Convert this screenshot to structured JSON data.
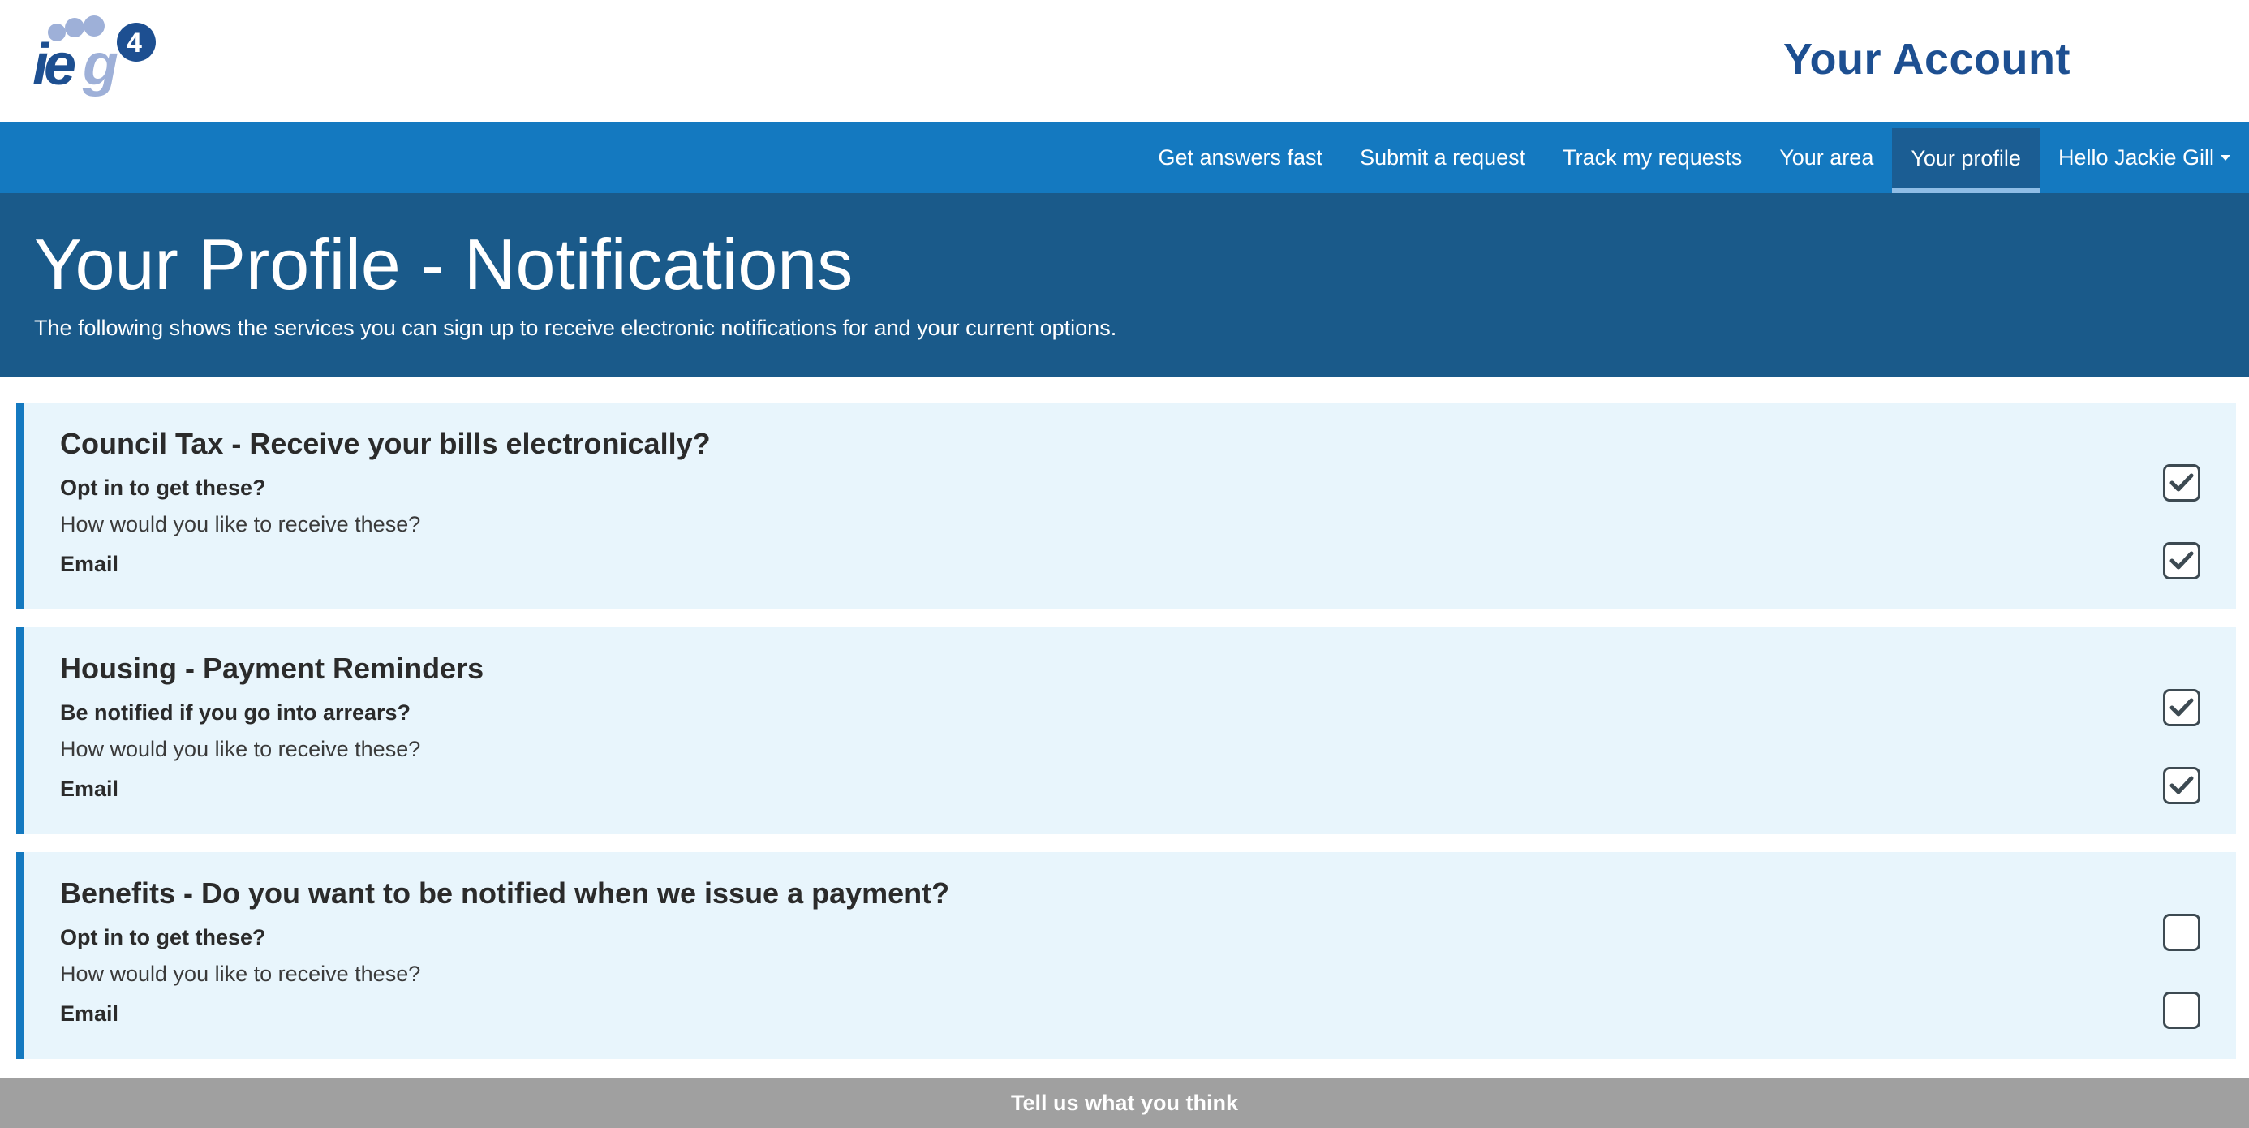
{
  "header": {
    "logo_text": "ieg4",
    "account_title": "Your Account"
  },
  "nav": {
    "items": [
      {
        "label": "Get answers fast",
        "active": false
      },
      {
        "label": "Submit a request",
        "active": false
      },
      {
        "label": "Track my requests",
        "active": false
      },
      {
        "label": "Your area",
        "active": false
      },
      {
        "label": "Your profile",
        "active": true
      }
    ],
    "user_menu_label": "Hello Jackie Gill"
  },
  "hero": {
    "title": "Your Profile - Notifications",
    "subtitle": "The following shows the services you can sign up to receive electronic notifications for and your current options."
  },
  "cards": [
    {
      "title": "Council Tax - Receive your bills electronically?",
      "question": "Opt in to get these?",
      "how": "How would you like to receive these?",
      "method": "Email",
      "opt_in_checked": true,
      "email_checked": true
    },
    {
      "title": "Housing - Payment Reminders",
      "question": "Be notified if you go into arrears?",
      "how": "How would you like to receive these?",
      "method": "Email",
      "opt_in_checked": true,
      "email_checked": true
    },
    {
      "title": "Benefits - Do you want to be notified when we issue a payment?",
      "question": "Opt in to get these?",
      "how": "How would you like to receive these?",
      "method": "Email",
      "opt_in_checked": false,
      "email_checked": false
    }
  ],
  "footer": {
    "feedback_label": "Tell us what you think"
  },
  "colors": {
    "brand_dark": "#1d4f91",
    "nav_blue": "#1479c0",
    "hero_blue": "#1a5a8a",
    "card_bg": "#e8f5fc",
    "feedback_grey": "#a0a0a0"
  }
}
